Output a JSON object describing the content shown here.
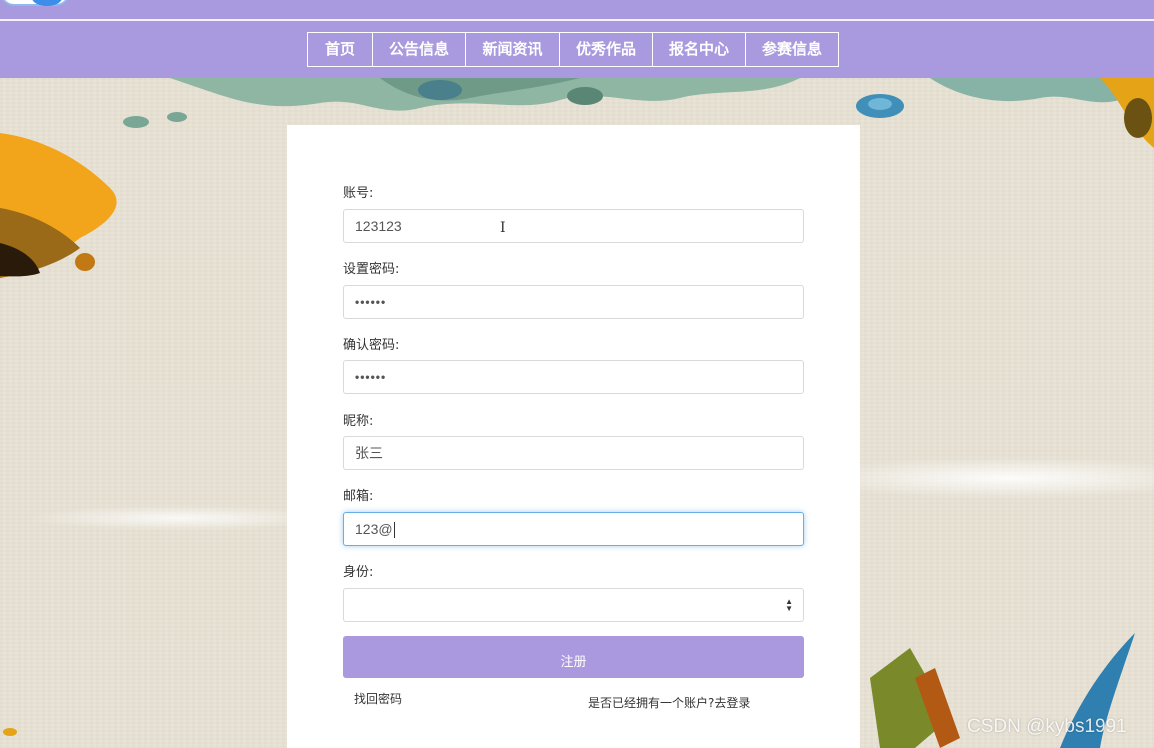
{
  "nav": {
    "items": [
      "首页",
      "公告信息",
      "新闻资讯",
      "优秀作品",
      "报名中心",
      "参赛信息"
    ]
  },
  "form": {
    "account": {
      "label": "账号:",
      "value": "123123"
    },
    "password": {
      "label": "设置密码:",
      "value": "••••••"
    },
    "confirm_password": {
      "label": "确认密码:",
      "value": "••••••"
    },
    "nickname": {
      "label": "昵称:",
      "value": "张三"
    },
    "email": {
      "label": "邮箱:",
      "value": "123@"
    },
    "identity": {
      "label": "身份:",
      "value": ""
    },
    "submit_label": "注册",
    "forgot_link": "找回密码",
    "login_link": "是否已经拥有一个账户?去登录"
  },
  "watermark": "CSDN @kybs1991",
  "colors": {
    "nav_bg": "#a999de",
    "button_bg": "#aa99de",
    "focus_border": "#66afe9",
    "page_bg": "#e8e2d4"
  }
}
